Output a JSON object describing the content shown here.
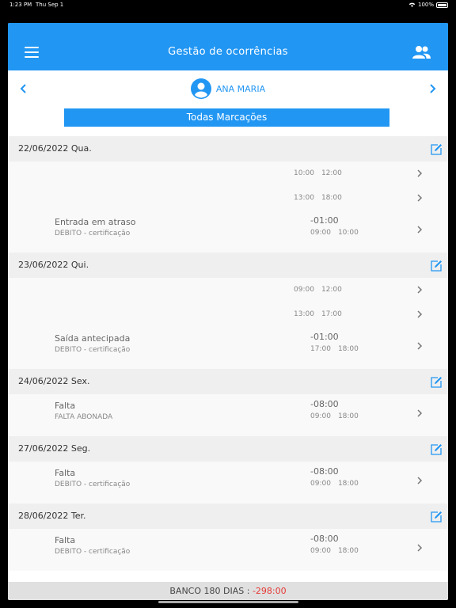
{
  "status": {
    "time": "1:23 PM",
    "date": "Thu Sep 1",
    "battery": "100%"
  },
  "appbar": {
    "title": "Gestão de ocorrências"
  },
  "user": {
    "name": "ANA MARIA"
  },
  "filter": {
    "label": "Todas Marcações"
  },
  "days": [
    {
      "date": "22/06/2022 Qua.",
      "punches": [
        {
          "in": "10:00",
          "out": "12:00"
        },
        {
          "in": "13:00",
          "out": "18:00"
        }
      ],
      "occurrence": {
        "title": "Entrada em atraso",
        "subtitle": "DEBITO - certificação",
        "value": "-01:00",
        "in": "09:00",
        "out": "10:00"
      }
    },
    {
      "date": "23/06/2022 Qui.",
      "punches": [
        {
          "in": "09:00",
          "out": "12:00"
        },
        {
          "in": "13:00",
          "out": "17:00"
        }
      ],
      "occurrence": {
        "title": "Saída antecipada",
        "subtitle": "DEBITO - certificação",
        "value": "-01:00",
        "in": "17:00",
        "out": "18:00"
      }
    },
    {
      "date": "24/06/2022 Sex.",
      "punches": [],
      "occurrence": {
        "title": "Falta",
        "subtitle": "FALTA ABONADA",
        "value": "-08:00",
        "in": "09:00",
        "out": "18:00"
      }
    },
    {
      "date": "27/06/2022 Seg.",
      "punches": [],
      "occurrence": {
        "title": "Falta",
        "subtitle": "DEBITO - certificação",
        "value": "-08:00",
        "in": "09:00",
        "out": "18:00"
      }
    },
    {
      "date": "28/06/2022 Ter.",
      "punches": [],
      "occurrence": {
        "title": "Falta",
        "subtitle": "DEBITO - certificação",
        "value": "-08:00",
        "in": "09:00",
        "out": "18:00"
      }
    }
  ],
  "footer": {
    "label": "BANCO 180 DIAS :",
    "value": "-298:00"
  },
  "colors": {
    "primary": "#2196f3",
    "negative": "#e53935"
  }
}
